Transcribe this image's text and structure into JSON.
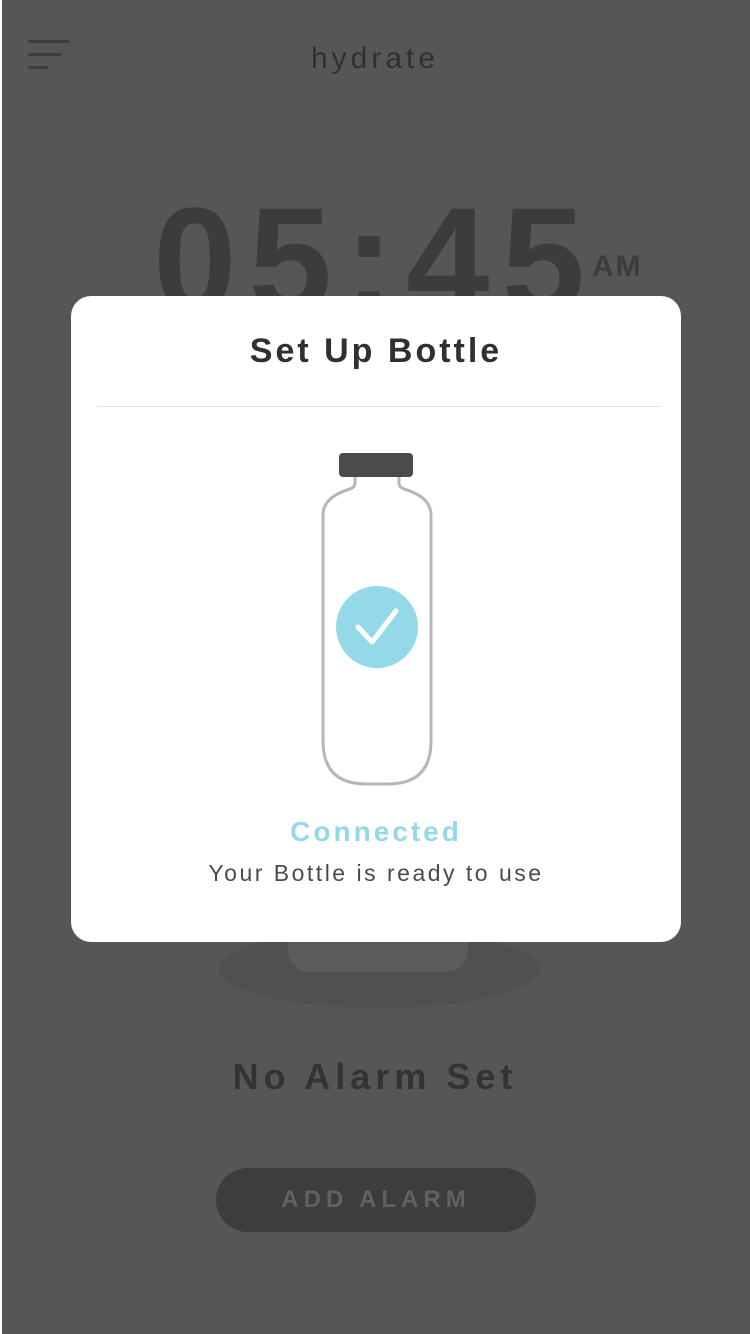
{
  "app": {
    "title": "hydrate"
  },
  "clock": {
    "time": "05:45",
    "suffix": "AM"
  },
  "alarm": {
    "status": "No Alarm Set",
    "add_button_label": "ADD ALARM"
  },
  "modal": {
    "title": "Set Up Bottle",
    "status_title": "Connected",
    "status_message": "Your Bottle is ready to use"
  },
  "colors": {
    "overlay_background": "#555657",
    "accent": "#93d9e7",
    "modal_background": "#ffffff",
    "bottle_cap": "#4a4b4d",
    "bottle_outline": "#b4b7bb"
  },
  "icons": {
    "menu": "hamburger-menu-icon",
    "bottle": "bottle-icon",
    "check": "check-circle-icon"
  }
}
